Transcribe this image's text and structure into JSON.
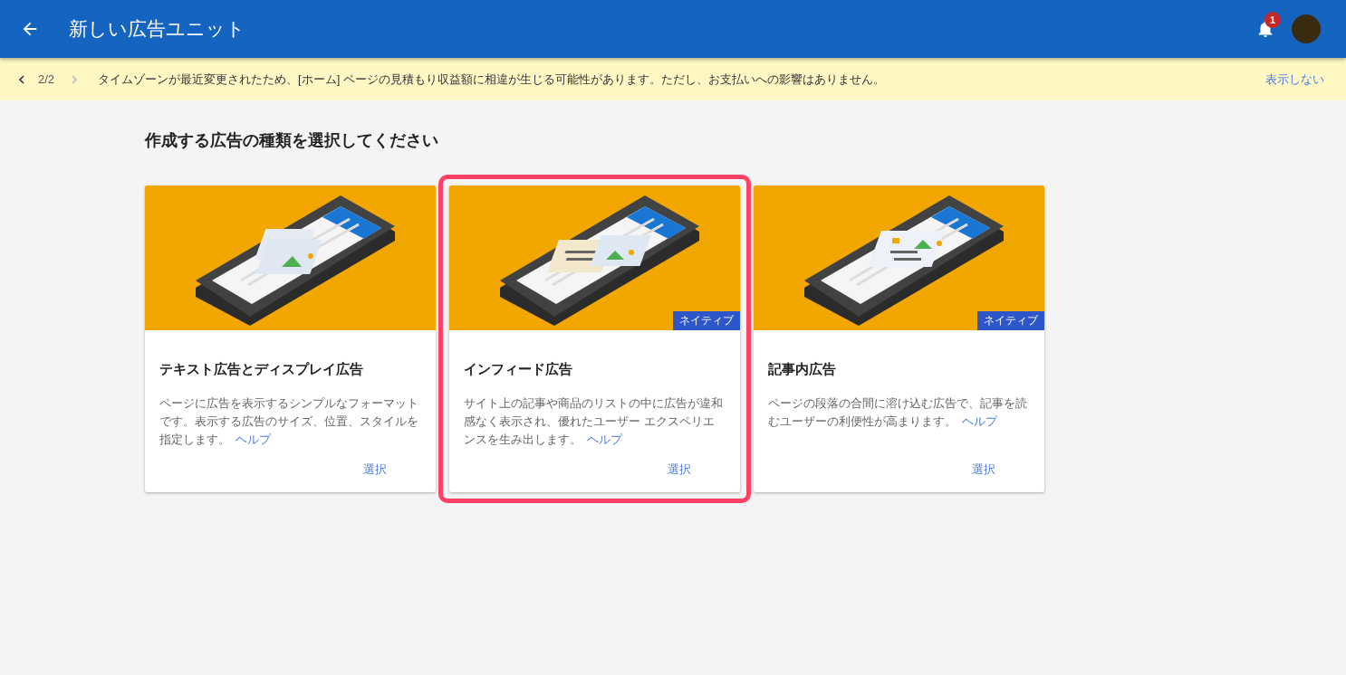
{
  "header": {
    "title": "新しい広告ユニット",
    "notification_count": "1"
  },
  "banner": {
    "pager": "2/2",
    "message": "タイムゾーンが最近変更されたため、[ホーム] ページの見積もり収益額に相違が生じる可能性があります。ただし、お支払いへの影響はありません。",
    "dismiss": "表示しない"
  },
  "heading": "作成する広告の種類を選択してください",
  "cards": [
    {
      "title": "テキスト広告とディスプレイ広告",
      "description": "ページに広告を表示するシンプルなフォーマットです。表示する広告のサイズ、位置、スタイルを指定します。",
      "help": "ヘルプ",
      "action": "選択",
      "selected": false,
      "kind": "display"
    },
    {
      "title": "インフィード広告",
      "description": "サイト上の記事や商品のリストの中に広告が違和感なく表示され、優れたユーザー エクスペリエンスを生み出します。",
      "help": "ヘルプ",
      "action": "選択",
      "badge": "ネイティブ",
      "selected": true,
      "kind": "infeed"
    },
    {
      "title": "記事内広告",
      "description": "ページの段落の合間に溶け込む広告で、記事を読むユーザーの利便性が高まります。",
      "help": "ヘルプ",
      "action": "選択",
      "badge": "ネイティブ",
      "selected": false,
      "kind": "inarticle"
    }
  ]
}
